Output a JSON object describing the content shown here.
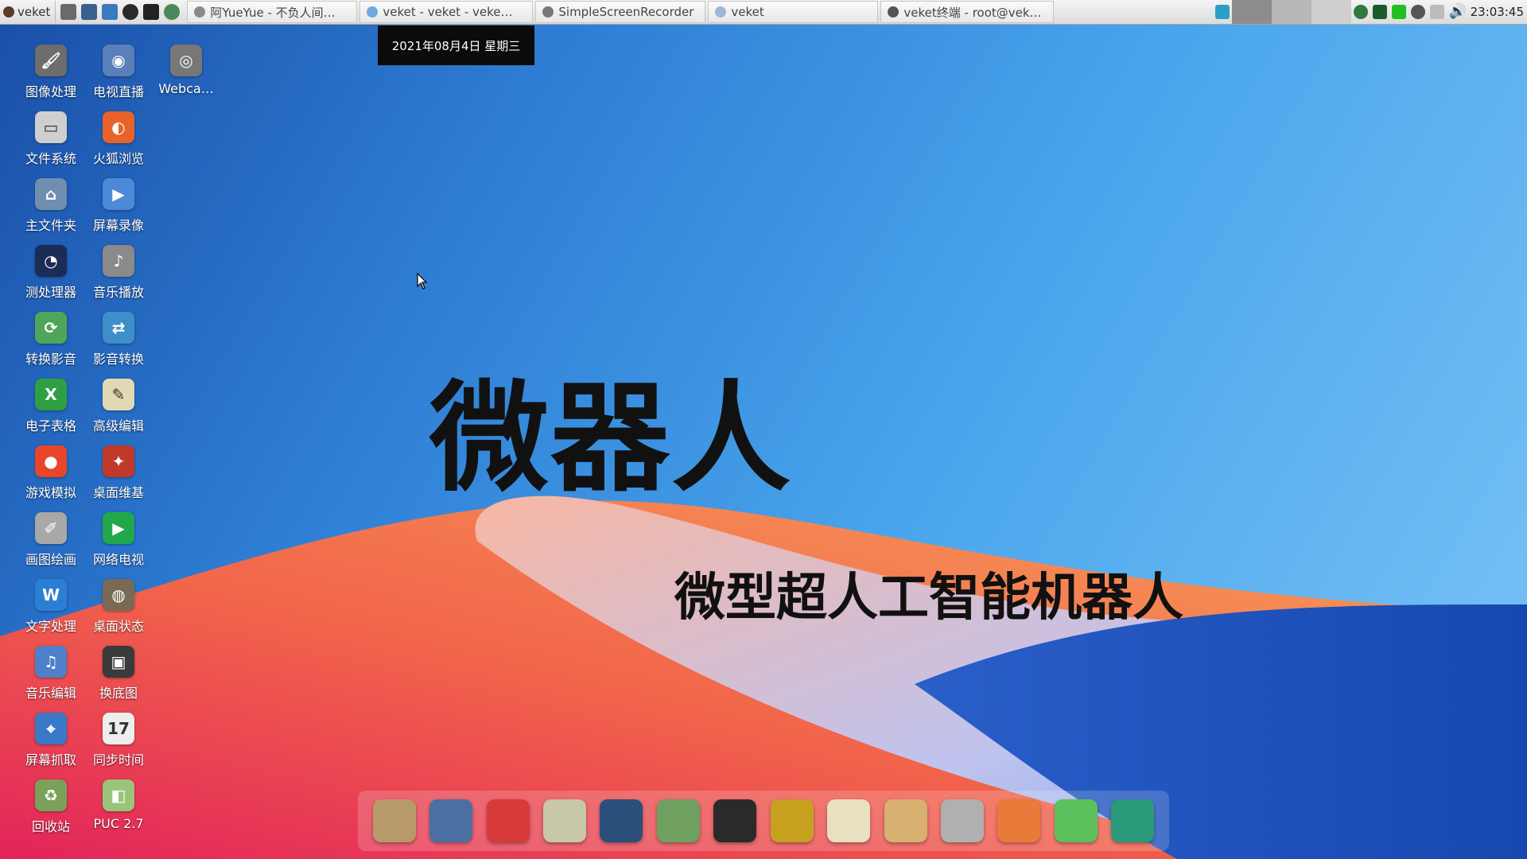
{
  "taskbar": {
    "start_label": "veket",
    "tasks": [
      {
        "label": "阿YueYue - 不负人间…",
        "color": "#8a8a8a"
      },
      {
        "label": "veket - veket - veke…",
        "color": "#6fa7e0"
      },
      {
        "label": "SimpleScreenRecorder",
        "color": "#777777"
      },
      {
        "label": "veket",
        "color": "#9fb7d6"
      },
      {
        "label": "veket终端 - root@vek…",
        "color": "#555555"
      }
    ],
    "clock": "23:03:45"
  },
  "date_tooltip": "2021年08月4日 星期三",
  "desktop_icons": [
    {
      "label": "图像处理",
      "icon": "gimp-icon",
      "color": "#6d6d6d",
      "glyph": "🖌"
    },
    {
      "label": "电视直播",
      "icon": "tv-icon",
      "color": "#5b7fb8",
      "glyph": "◉"
    },
    {
      "label": "Webca…",
      "icon": "webcam-icon",
      "color": "#777777",
      "glyph": "◎"
    },
    {
      "label": "文件系统",
      "icon": "drive-icon",
      "color": "#cfcfcf",
      "glyph": "▭"
    },
    {
      "label": "火狐浏览",
      "icon": "firefox-icon",
      "color": "#e8632a",
      "glyph": "◐"
    },
    {
      "label": "主文件夹",
      "icon": "home-folder-icon",
      "color": "#6f8fb0",
      "glyph": "⌂"
    },
    {
      "label": "屏幕录像",
      "icon": "screen-record-icon",
      "color": "#4a8ad8",
      "glyph": "▶"
    },
    {
      "label": "测处理器",
      "icon": "cpu-test-icon",
      "color": "#1b2d55",
      "glyph": "◔"
    },
    {
      "label": "音乐播放",
      "icon": "music-player-icon",
      "color": "#8a8a8a",
      "glyph": "♪"
    },
    {
      "label": "转换影音",
      "icon": "convert-media-icon",
      "color": "#4fa55a",
      "glyph": "⟳"
    },
    {
      "label": "影音转换",
      "icon": "media-convert-icon",
      "color": "#3c8fc8",
      "glyph": "⇄"
    },
    {
      "label": "电子表格",
      "icon": "spreadsheet-icon",
      "color": "#2ea043",
      "glyph": "X"
    },
    {
      "label": "高级编辑",
      "icon": "editor-icon",
      "color": "#e0d9b4",
      "glyph": "✎"
    },
    {
      "label": "游戏模拟",
      "icon": "game-emulator-icon",
      "color": "#e8452a",
      "glyph": "●"
    },
    {
      "label": "桌面维基",
      "icon": "wiki-icon",
      "color": "#c0392b",
      "glyph": "✦"
    },
    {
      "label": "画图绘画",
      "icon": "paint-icon",
      "color": "#a8a8a8",
      "glyph": "✐"
    },
    {
      "label": "网络电视",
      "icon": "net-tv-icon",
      "color": "#22a84a",
      "glyph": "▶"
    },
    {
      "label": "文字处理",
      "icon": "word-processor-icon",
      "color": "#2a7fd4",
      "glyph": "W"
    },
    {
      "label": "桌面状态",
      "icon": "desktop-status-icon",
      "color": "#7a6a55",
      "glyph": "◍"
    },
    {
      "label": "音乐编辑",
      "icon": "audio-editor-icon",
      "color": "#4f7fc8",
      "glyph": "♫"
    },
    {
      "label": "换底图",
      "icon": "wallpaper-icon",
      "color": "#3a3a3a",
      "glyph": "▣"
    },
    {
      "label": "屏幕抓取",
      "icon": "screenshot-icon",
      "color": "#3a78c8",
      "glyph": "⌖"
    },
    {
      "label": "同步时间",
      "icon": "calendar-icon",
      "color": "#eeeeee",
      "glyph": "17"
    },
    {
      "label": "回收站",
      "icon": "trash-icon",
      "color": "#7aa05a",
      "glyph": "♻"
    },
    {
      "label": "PUC 2.7",
      "icon": "puc-icon",
      "color": "#9ac47a",
      "glyph": "◧"
    }
  ],
  "wallpaper": {
    "title": "微器人",
    "subtitle": "微型超人工智能机器人"
  },
  "dock_icons": [
    {
      "icon": "file-manager-icon",
      "color": "#b89a6a"
    },
    {
      "icon": "monitor-icon",
      "color": "#4a6fa0"
    },
    {
      "icon": "pet-icon",
      "color": "#d83a3a"
    },
    {
      "icon": "notepad-icon",
      "color": "#c8c8a8"
    },
    {
      "icon": "media-player-icon",
      "color": "#2a4f7a"
    },
    {
      "icon": "network-icon",
      "color": "#6fa060"
    },
    {
      "icon": "qq-penguin-icon",
      "color": "#2a2a2a"
    },
    {
      "icon": "notebook-icon",
      "color": "#c8a020"
    },
    {
      "icon": "chart-icon",
      "color": "#e8e0c0"
    },
    {
      "icon": "palette-icon",
      "color": "#d8b070"
    },
    {
      "icon": "usb-drive-icon",
      "color": "#b0b0b0"
    },
    {
      "icon": "image-viewer-icon",
      "color": "#e87a3a"
    },
    {
      "icon": "help-icon",
      "color": "#5cc05c"
    },
    {
      "icon": "camera-icon",
      "color": "#2a9a7a"
    }
  ]
}
